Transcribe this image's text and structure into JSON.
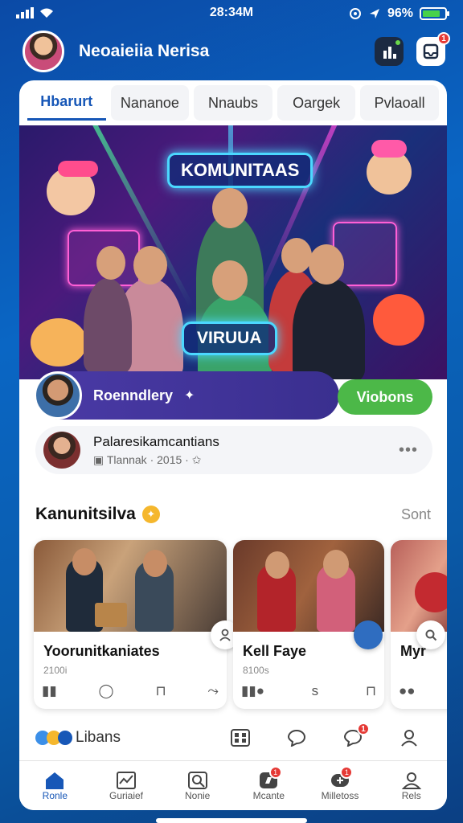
{
  "status": {
    "time": "28:34M",
    "battery": "96%",
    "battery_level": 0.8
  },
  "header": {
    "username": "Neoaieiia Nerisa",
    "notif_count": "1"
  },
  "tabs": [
    {
      "label": "Hbarurt"
    },
    {
      "label": "Nananoe"
    },
    {
      "label": "Nnaubs"
    },
    {
      "label": "Oargek"
    },
    {
      "label": "Pvlaoall"
    }
  ],
  "hero": {
    "sign_top": "KOMUNITAAS",
    "sign_bottom": "VIRUUA",
    "host_name": "Roenndlery",
    "join_label": "Viobons"
  },
  "post": {
    "title": "Palaresikamcantians",
    "meta": "Tlannak · 2015 ·"
  },
  "section": {
    "title": "Kanunitsilva",
    "see_all": "Sont"
  },
  "cards": [
    {
      "title": "Yoorunitkaniates",
      "meta": "2100i"
    },
    {
      "title": "Kell Faye",
      "meta": "8100s"
    },
    {
      "title": "Myr",
      "meta": ""
    }
  ],
  "quick": {
    "brand": "Libans",
    "badge": "1"
  },
  "nav": [
    {
      "label": "Ronle"
    },
    {
      "label": "Guriaief"
    },
    {
      "label": "Nonie"
    },
    {
      "label": "Mcante",
      "badge": "1"
    },
    {
      "label": "Milletoss",
      "badge": "1"
    },
    {
      "label": "Rels"
    }
  ],
  "colors": {
    "accent": "#1757b7",
    "join": "#4cb848",
    "badge": "#e53935"
  }
}
